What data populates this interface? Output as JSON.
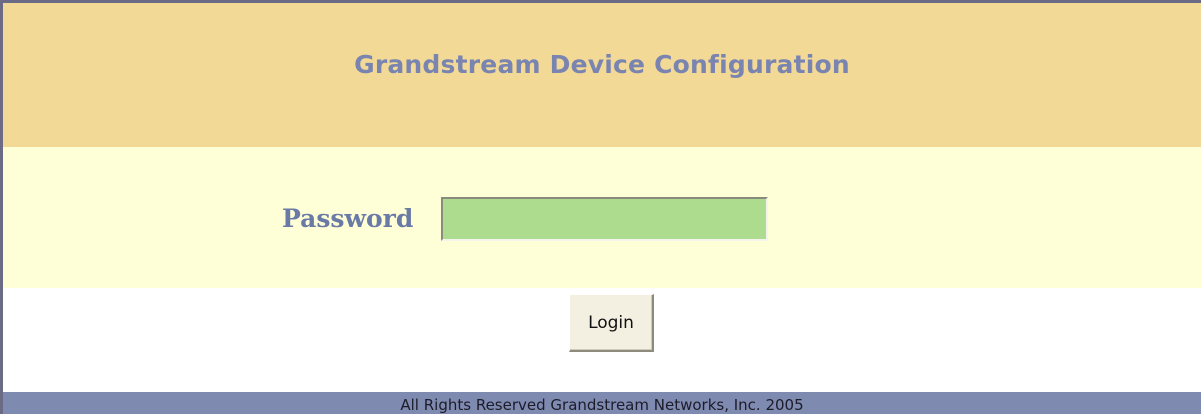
{
  "header": {
    "title": "Grandstream Device Configuration"
  },
  "login_form": {
    "password_label": "Password",
    "password_value": "",
    "login_button_label": "Login"
  },
  "footer": {
    "copyright": "All Rights Reserved Grandstream Networks, Inc. 2005"
  },
  "colors": {
    "header_bg": "#f2d995",
    "title_text": "#7a84b0",
    "password_band_bg": "#ffffd7",
    "password_input_bg": "#addc8e",
    "footer_bg": "#7f8ab0"
  }
}
